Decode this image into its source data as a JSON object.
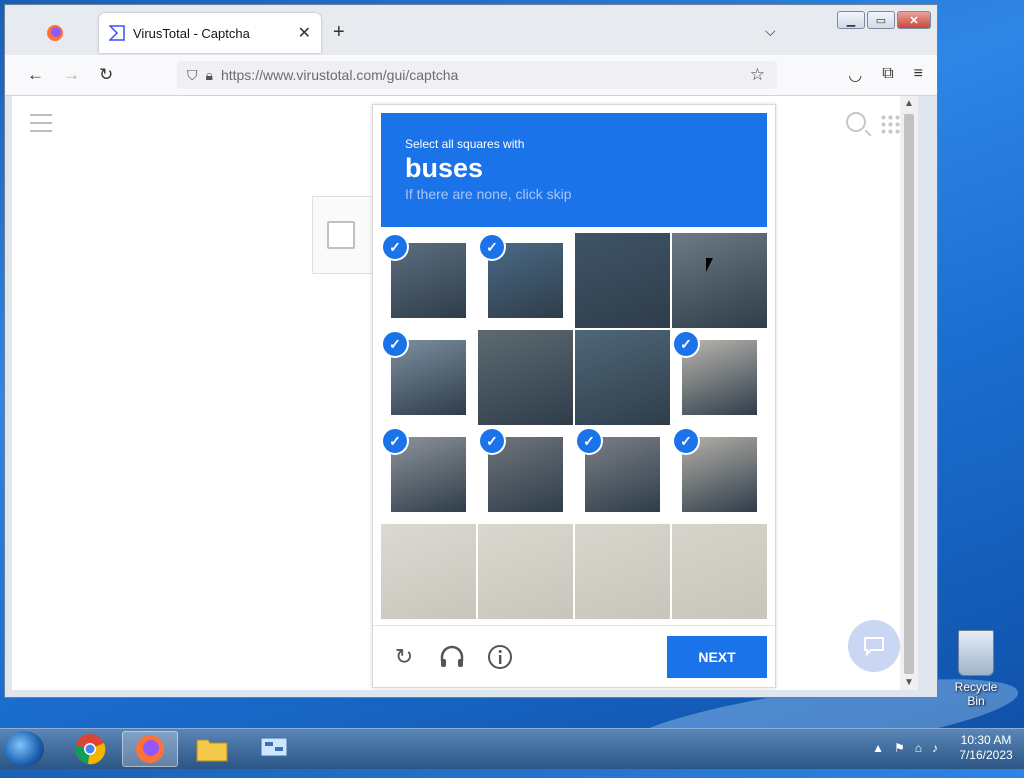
{
  "browser": {
    "tab_title": "VirusTotal - Captcha",
    "tab_close": "✕",
    "new_tab": "+",
    "tabs_menu": "⌵",
    "url": "https://www.virustotal.com/gui/captcha"
  },
  "captcha": {
    "instruction": "Select all squares with",
    "target": "buses",
    "hint": "If there are none, click skip",
    "next_label": "NEXT",
    "tiles": [
      {
        "selected": true,
        "color": "#5c6e80"
      },
      {
        "selected": true,
        "color": "#4a6a86"
      },
      {
        "selected": false,
        "color": "#3f5468"
      },
      {
        "selected": false,
        "color": "#6e7a84"
      },
      {
        "selected": true,
        "color": "#7c8ea0"
      },
      {
        "selected": false,
        "color": "#5d6a72"
      },
      {
        "selected": false,
        "color": "#4f6778"
      },
      {
        "selected": true,
        "color": "#b9b6ae"
      },
      {
        "selected": true,
        "color": "#8d939a"
      },
      {
        "selected": true,
        "color": "#6f757c"
      },
      {
        "selected": true,
        "color": "#7a7f86"
      },
      {
        "selected": true,
        "color": "#b3b0a8"
      },
      {
        "selected": false,
        "color": "#dcd9d2"
      },
      {
        "selected": false,
        "color": "#dad7cf"
      },
      {
        "selected": false,
        "color": "#d8d5cd"
      },
      {
        "selected": false,
        "color": "#d6d3cb"
      }
    ]
  },
  "desktop": {
    "recycle_bin_label": "Recycle Bin",
    "clock_time": "10:30 AM",
    "clock_date": "7/16/2023"
  },
  "colors": {
    "accent": "#1a73e8"
  }
}
